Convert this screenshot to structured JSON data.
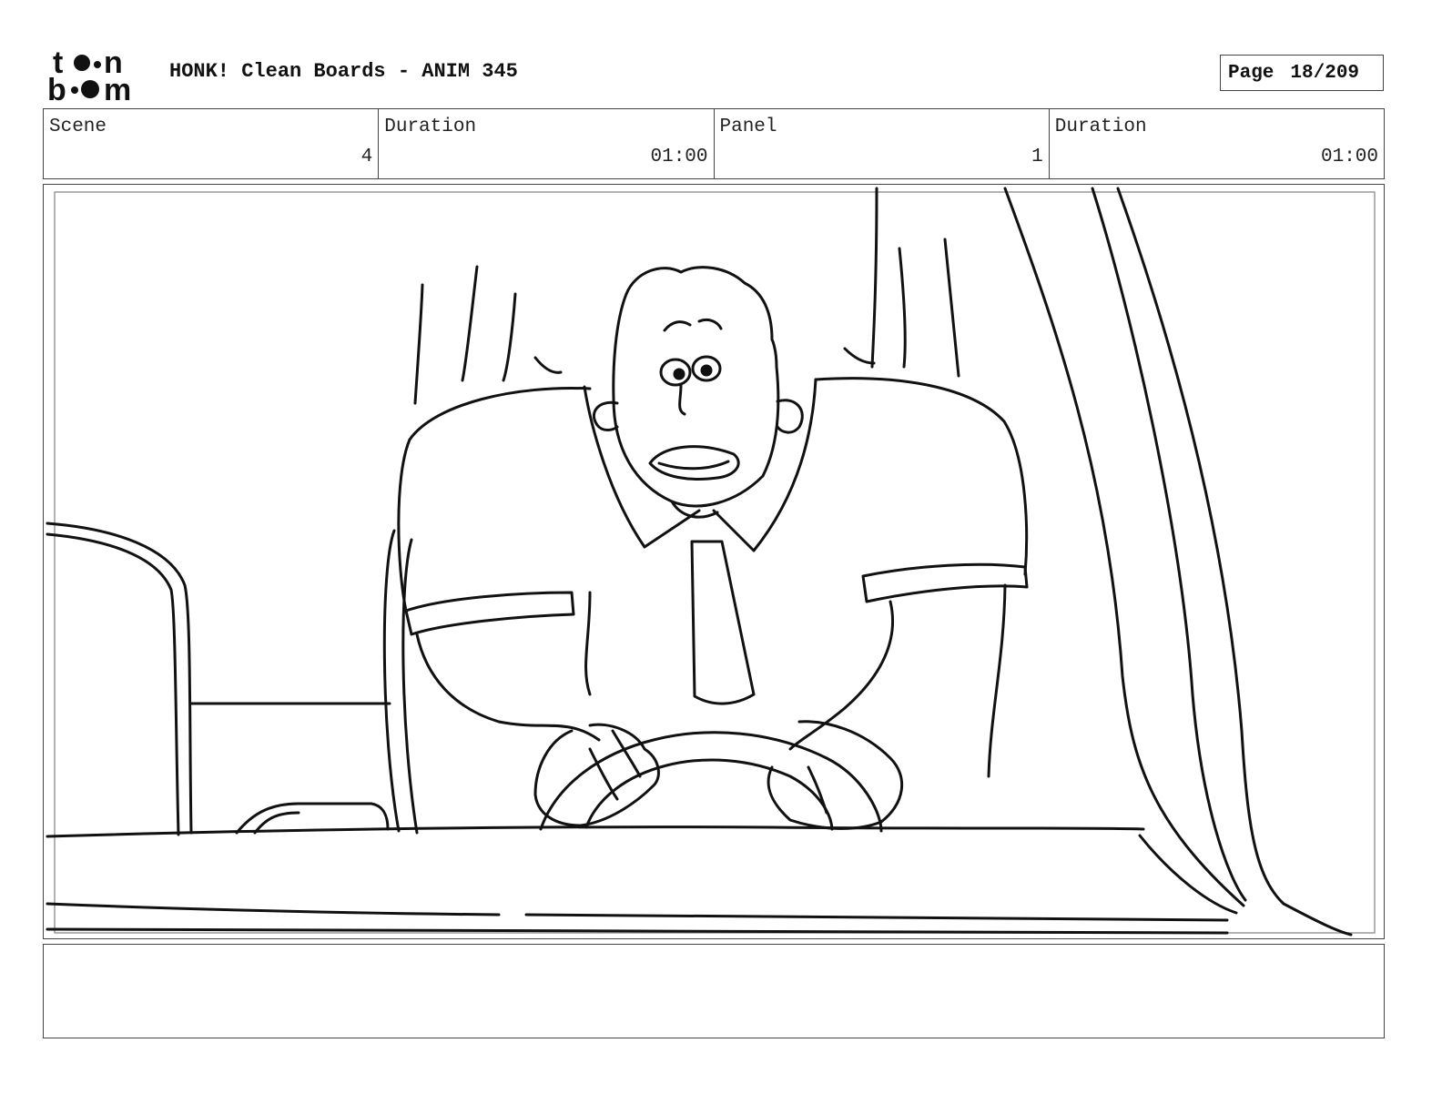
{
  "header": {
    "logo_text_top": "toon",
    "logo_text_bottom": "boom",
    "title": "HONK! Clean Boards - ANIM 345",
    "page_label": "Page",
    "page_number": "18/209"
  },
  "info": {
    "scene_label": "Scene",
    "scene_value": "4",
    "scene_duration_label": "Duration",
    "scene_duration_value": "01:00",
    "panel_label": "Panel",
    "panel_value": "1",
    "panel_duration_label": "Duration",
    "panel_duration_value": "01:00"
  },
  "notes": {
    "text": ""
  }
}
